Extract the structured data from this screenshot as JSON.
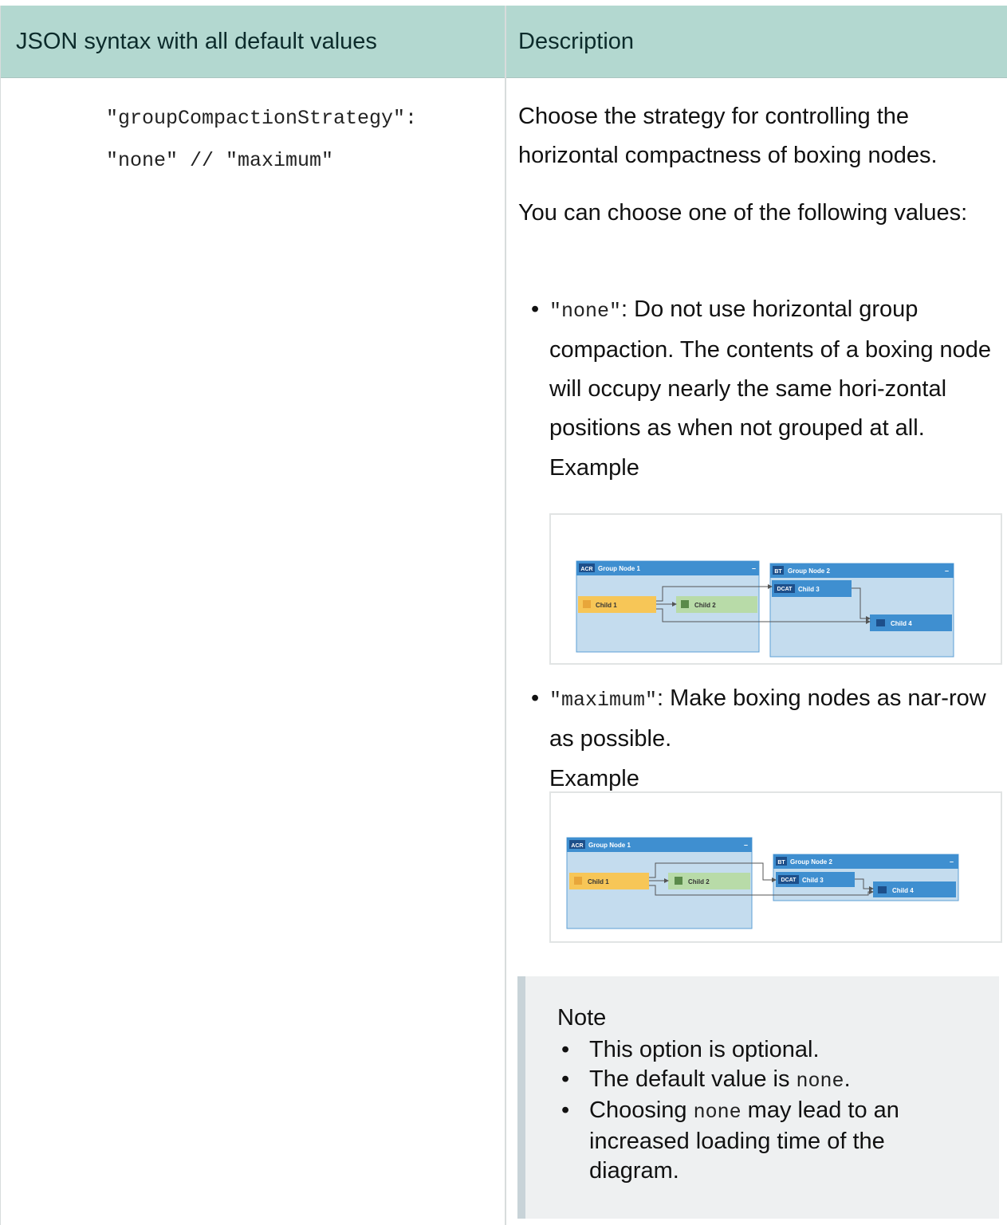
{
  "table": {
    "header": {
      "col1": "JSON syntax with all default values",
      "col2": "Description"
    },
    "code_lines": [
      "\"groupCompactionStrategy\":",
      "\"none\" // \"maximum\""
    ],
    "description": {
      "intro": "Choose the strategy for controlling the horizontal compactness of boxing nodes.",
      "choose": "You can choose one of the following values:",
      "options": [
        {
          "value": "\"none\"",
          "text": ": Do not use horizontal group compaction. The contents of a boxing node will occupy nearly the same hori-zontal positions as when not grouped at all.",
          "example_label": "Example"
        },
        {
          "value": "\"maximum\"",
          "text": ": Make boxing nodes as nar-row as possible.",
          "example_label": "Example"
        }
      ]
    },
    "diagram_labels": {
      "group1_badge": "ACR",
      "group1_title": "Group Node 1",
      "group2_badge": "BT",
      "group2_title": "Group Node 2",
      "child1": "Child 1",
      "child2": "Child 2",
      "child3_badge": "DCAT",
      "child3": "Child 3",
      "child4": "Child 4",
      "collapse": "–"
    },
    "note": {
      "title": "Note",
      "items": [
        {
          "text": "This option is optional."
        },
        {
          "pre": "The default value is ",
          "code": "none",
          "post": "."
        },
        {
          "pre": "Choosing ",
          "code": "none",
          "post": " may lead to an increased loading time of the diagram."
        }
      ]
    }
  }
}
